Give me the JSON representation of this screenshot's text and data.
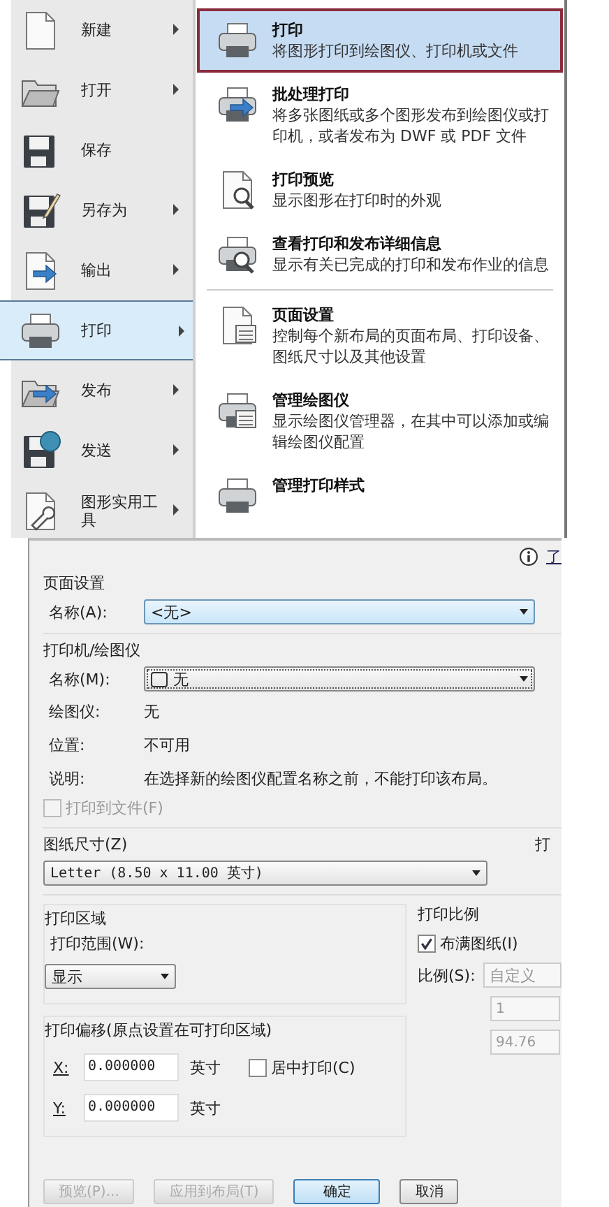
{
  "menu": {
    "items": [
      {
        "label": "新建",
        "arrow": true,
        "selected": false
      },
      {
        "label": "打开",
        "arrow": true,
        "selected": false
      },
      {
        "label": "保存",
        "arrow": false,
        "selected": false
      },
      {
        "label": "另存为",
        "arrow": true,
        "selected": false
      },
      {
        "label": "输出",
        "arrow": true,
        "selected": false
      },
      {
        "label": "打印",
        "arrow": true,
        "selected": true
      },
      {
        "label": "发布",
        "arrow": true,
        "selected": false
      },
      {
        "label": "发送",
        "arrow": true,
        "selected": false
      },
      {
        "label": "图形实用工具",
        "arrow": true,
        "selected": false
      }
    ]
  },
  "submenu": {
    "groups": [
      [
        {
          "title": "打印",
          "desc": "将图形打印到绘图仪、打印机或文件",
          "selected": true
        },
        {
          "title": "批处理打印",
          "desc": "将多张图纸或多个图形发布到绘图仪或打印机，或者发布为 DWF 或 PDF 文件",
          "selected": false
        },
        {
          "title": "打印预览",
          "desc": "显示图形在打印时的外观",
          "selected": false
        },
        {
          "title": "查看打印和发布详细信息",
          "desc": "显示有关已完成的打印和发布作业的信息",
          "selected": false
        }
      ],
      [
        {
          "title": "页面设置",
          "desc": "控制每个新布局的页面布局、打印设备、图纸尺寸以及其他设置",
          "selected": false
        },
        {
          "title": "管理绘图仪",
          "desc": "显示绘图仪管理器，在其中可以添加或编辑绘图仪配置",
          "selected": false
        },
        {
          "title": "管理打印样式",
          "selected": false
        }
      ]
    ]
  },
  "dialog": {
    "help_link": "了",
    "page_setup": {
      "title": "页面设置",
      "name_label": "名称(A):",
      "name_value": "<无>"
    },
    "printer": {
      "title": "打印机/绘图仪",
      "name_label": "名称(M):",
      "name_value": "无",
      "rows": [
        {
          "label": "绘图仪:",
          "value": "无"
        },
        {
          "label": "位置:",
          "value": "不可用"
        },
        {
          "label": "说明:",
          "value": "在选择新的绘图仪配置名称之前，不能打印该布局。"
        }
      ],
      "print_to_file": {
        "label": "打印到文件(F)",
        "checked": false,
        "disabled": true
      }
    },
    "paper_size": {
      "title": "图纸尺寸(Z)",
      "value": "Letter (8.50 x 11.00 英寸)"
    },
    "cut_label": "打",
    "print_area": {
      "title": "打印区域",
      "range_label": "打印范围(W):",
      "range_value": "显示"
    },
    "offset": {
      "title": "打印偏移(原点设置在可打印区域)",
      "x_label": "X:",
      "x_value": "0.000000",
      "y_label": "Y:",
      "y_value": "0.000000",
      "x_unit": "英寸",
      "y_unit": "英寸",
      "center": {
        "label": "居中打印(C)",
        "checked": false
      }
    },
    "scale": {
      "title": "打印比例",
      "fit": {
        "label": "布满图纸(I)",
        "checked": true
      },
      "scale_label": "比例(S):",
      "scale_value": "自定义",
      "value1": "1",
      "value2": "94.76"
    },
    "buttons": [
      {
        "label": "预览(P)...",
        "disabled": true,
        "default": false
      },
      {
        "label": "应用到布局(T)",
        "disabled": true,
        "default": false
      },
      {
        "label": "确定",
        "disabled": false,
        "default": true
      },
      {
        "label": "取消",
        "disabled": false,
        "default": false
      }
    ]
  }
}
